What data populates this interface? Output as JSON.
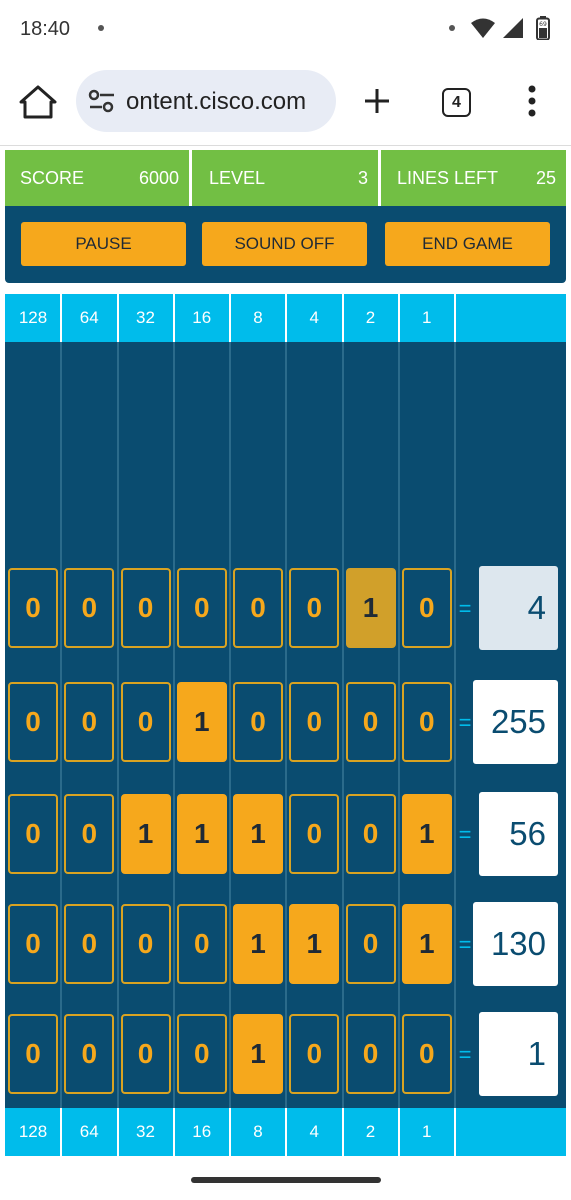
{
  "status": {
    "time": "18:40",
    "battery_level": "69"
  },
  "browser": {
    "url": "ontent.cisco.com",
    "tab_count": "4"
  },
  "header": {
    "score_label": "SCORE",
    "score_value": "6000",
    "level_label": "LEVEL",
    "level_value": "3",
    "lines_label": "LINES LEFT",
    "lines_value": "25"
  },
  "buttons": {
    "pause": "PAUSE",
    "sound": "SOUND OFF",
    "end": "END GAME"
  },
  "bit_values": [
    "128",
    "64",
    "32",
    "16",
    "8",
    "4",
    "2",
    "1"
  ],
  "equals_sign": "=",
  "rows": [
    {
      "bits": [
        "0",
        "0",
        "0",
        "0",
        "0",
        "0",
        "1",
        "0"
      ],
      "answer": "4"
    },
    {
      "bits": [
        "0",
        "0",
        "0",
        "1",
        "0",
        "0",
        "0",
        "0"
      ],
      "answer": "255"
    },
    {
      "bits": [
        "0",
        "0",
        "1",
        "1",
        "1",
        "0",
        "0",
        "1"
      ],
      "answer": "56"
    },
    {
      "bits": [
        "0",
        "0",
        "0",
        "0",
        "1",
        "1",
        "0",
        "1"
      ],
      "answer": "130"
    },
    {
      "bits": [
        "0",
        "0",
        "0",
        "0",
        "1",
        "0",
        "0",
        "0"
      ],
      "answer": "1"
    }
  ],
  "colors": {
    "board": "#0a4c70",
    "header_green": "#72bf44",
    "accent_orange": "#f6a81c",
    "bit_row_blue": "#00bceb"
  },
  "icons": {
    "home": "home-icon",
    "site_settings": "tune-icon",
    "new_tab": "plus-icon",
    "menu": "more-vert-icon"
  }
}
